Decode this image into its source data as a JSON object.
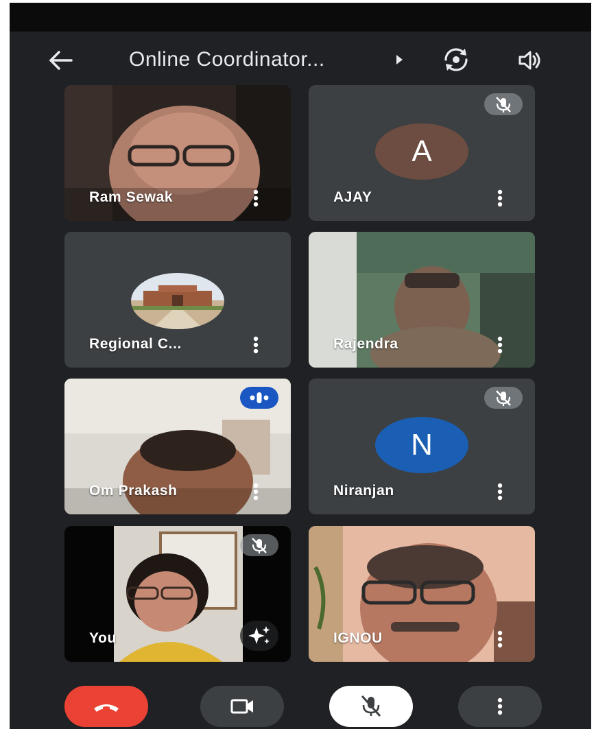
{
  "header": {
    "meeting_title": "Online Coordinator...",
    "icons": [
      "back-arrow-icon",
      "caret-right-icon",
      "switch-camera-icon",
      "speaker-icon"
    ]
  },
  "participants": [
    {
      "name": "Ram Sewak",
      "kind": "video",
      "muted": false
    },
    {
      "name": "AJAY",
      "kind": "avatar",
      "initial": "A",
      "avatar_color": "#6d4c41",
      "muted": true
    },
    {
      "name": "Regional C...",
      "kind": "photo-avatar",
      "muted": false
    },
    {
      "name": "Rajendra",
      "kind": "video",
      "muted": false
    },
    {
      "name": "Om Prakash",
      "kind": "video",
      "muted": false,
      "speaking": true
    },
    {
      "name": "Niranjan",
      "kind": "avatar",
      "initial": "N",
      "avatar_color": "#1a5fb4",
      "muted": true
    },
    {
      "name": "You",
      "kind": "video",
      "muted": true,
      "effects_button": true
    },
    {
      "name": "IGNOU",
      "kind": "video",
      "muted": false
    }
  ],
  "controls": {
    "end_call_color": "#ea4335",
    "icons": [
      "end-call-icon",
      "camera-icon",
      "mic-off-icon",
      "more-vertical-icon"
    ]
  },
  "colors": {
    "background": "#202124",
    "tile": "#3c4043",
    "speaking_badge": "#1a57c2"
  }
}
